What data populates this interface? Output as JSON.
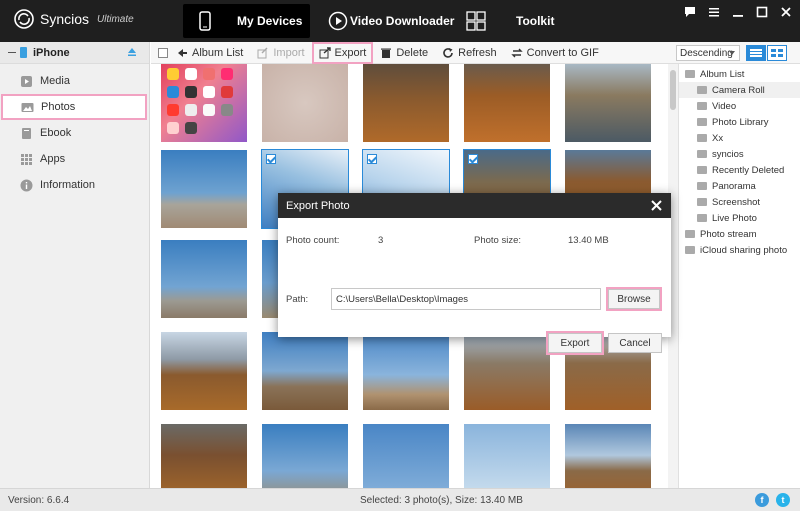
{
  "app": {
    "name": "Syncios",
    "edition": "Ultimate"
  },
  "nav": {
    "tabs": [
      {
        "label": "My Devices"
      },
      {
        "label": "Video Downloader"
      },
      {
        "label": "Toolkit"
      }
    ]
  },
  "device": {
    "name": "iPhone"
  },
  "sidebar": {
    "items": [
      {
        "label": "Media",
        "icon": "media-icon"
      },
      {
        "label": "Photos",
        "icon": "photos-icon"
      },
      {
        "label": "Ebook",
        "icon": "ebook-icon"
      },
      {
        "label": "Apps",
        "icon": "apps-icon"
      },
      {
        "label": "Information",
        "icon": "info-icon"
      }
    ]
  },
  "toolbar": {
    "album_list": "Album List",
    "import": "Import",
    "export": "Export",
    "delete": "Delete",
    "refresh": "Refresh",
    "convert_gif": "Convert to GIF",
    "sort": "Descending"
  },
  "albums": {
    "root": "Album List",
    "items": [
      "Camera Roll",
      "Video",
      "Photo Library",
      "Xx",
      "syncios",
      "Recently Deleted",
      "Panorama",
      "Screenshot",
      "Live Photo"
    ],
    "stream": "Photo stream",
    "icloud": "iCloud sharing photo"
  },
  "dialog": {
    "title": "Export Photo",
    "count_label": "Photo count:",
    "count_value": "3",
    "size_label": "Photo size:",
    "size_value": "13.40 MB",
    "path_label": "Path:",
    "path_value": "C:\\Users\\Bella\\Desktop\\Images",
    "browse": "Browse",
    "export": "Export",
    "cancel": "Cancel"
  },
  "status": {
    "version": "Version: 6.6.4",
    "selection": "Selected: 3 photo(s), Size: 13.40 MB"
  },
  "colors": {
    "accent_pink": "#f2a2c2",
    "accent_blue": "#2a8ad8",
    "titlebar": "#1f1f1f",
    "facebook": "#3b9bdc",
    "twitter": "#29b3ea"
  }
}
